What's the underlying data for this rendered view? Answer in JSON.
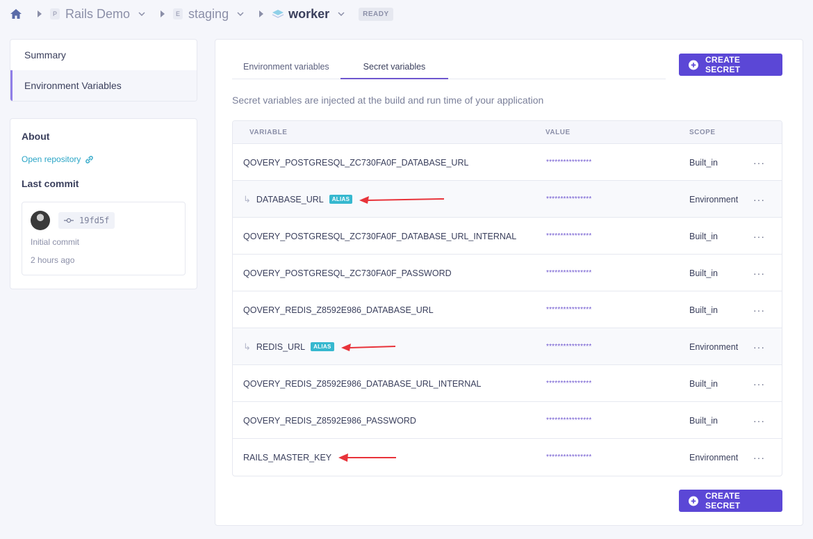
{
  "breadcrumb": {
    "project_badge": "P",
    "project": "Rails Demo",
    "env_badge": "E",
    "environment": "staging",
    "application": "worker",
    "status": "READY"
  },
  "sidebar": {
    "items": [
      {
        "label": "Summary"
      },
      {
        "label": "Environment Variables"
      }
    ]
  },
  "about": {
    "title": "About",
    "repo_link": "Open repository",
    "last_commit_title": "Last commit",
    "commit_hash": "19fd5f",
    "commit_message": "Initial commit",
    "commit_time": "2 hours ago"
  },
  "main": {
    "tabs": [
      {
        "label": "Environment variables"
      },
      {
        "label": "Secret variables"
      }
    ],
    "create_button": "CREATE SECRET",
    "description": "Secret variables are injected at the build and run time of your application",
    "columns": {
      "variable": "VARIABLE",
      "value": "VALUE",
      "scope": "SCOPE"
    },
    "alias_label": "ALIAS",
    "rows": [
      {
        "variable": "QOVERY_POSTGRESQL_ZC730FA0F_DATABASE_URL",
        "value": "****************",
        "scope": "Built_in"
      },
      {
        "variable": "DATABASE_URL",
        "value": "****************",
        "scope": "Environment"
      },
      {
        "variable": "QOVERY_POSTGRESQL_ZC730FA0F_DATABASE_URL_INTERNAL",
        "value": "****************",
        "scope": "Built_in"
      },
      {
        "variable": "QOVERY_POSTGRESQL_ZC730FA0F_PASSWORD",
        "value": "****************",
        "scope": "Built_in"
      },
      {
        "variable": "QOVERY_REDIS_Z8592E986_DATABASE_URL",
        "value": "****************",
        "scope": "Built_in"
      },
      {
        "variable": "REDIS_URL",
        "value": "****************",
        "scope": "Environment"
      },
      {
        "variable": "QOVERY_REDIS_Z8592E986_DATABASE_URL_INTERNAL",
        "value": "****************",
        "scope": "Built_in"
      },
      {
        "variable": "QOVERY_REDIS_Z8592E986_PASSWORD",
        "value": "****************",
        "scope": "Built_in"
      },
      {
        "variable": "RAILS_MASTER_KEY",
        "value": "****************",
        "scope": "Environment"
      }
    ]
  },
  "colors": {
    "accent": "#5b47d6",
    "alias_badge": "#36b8cf",
    "annotation_arrow": "#e8333a"
  }
}
